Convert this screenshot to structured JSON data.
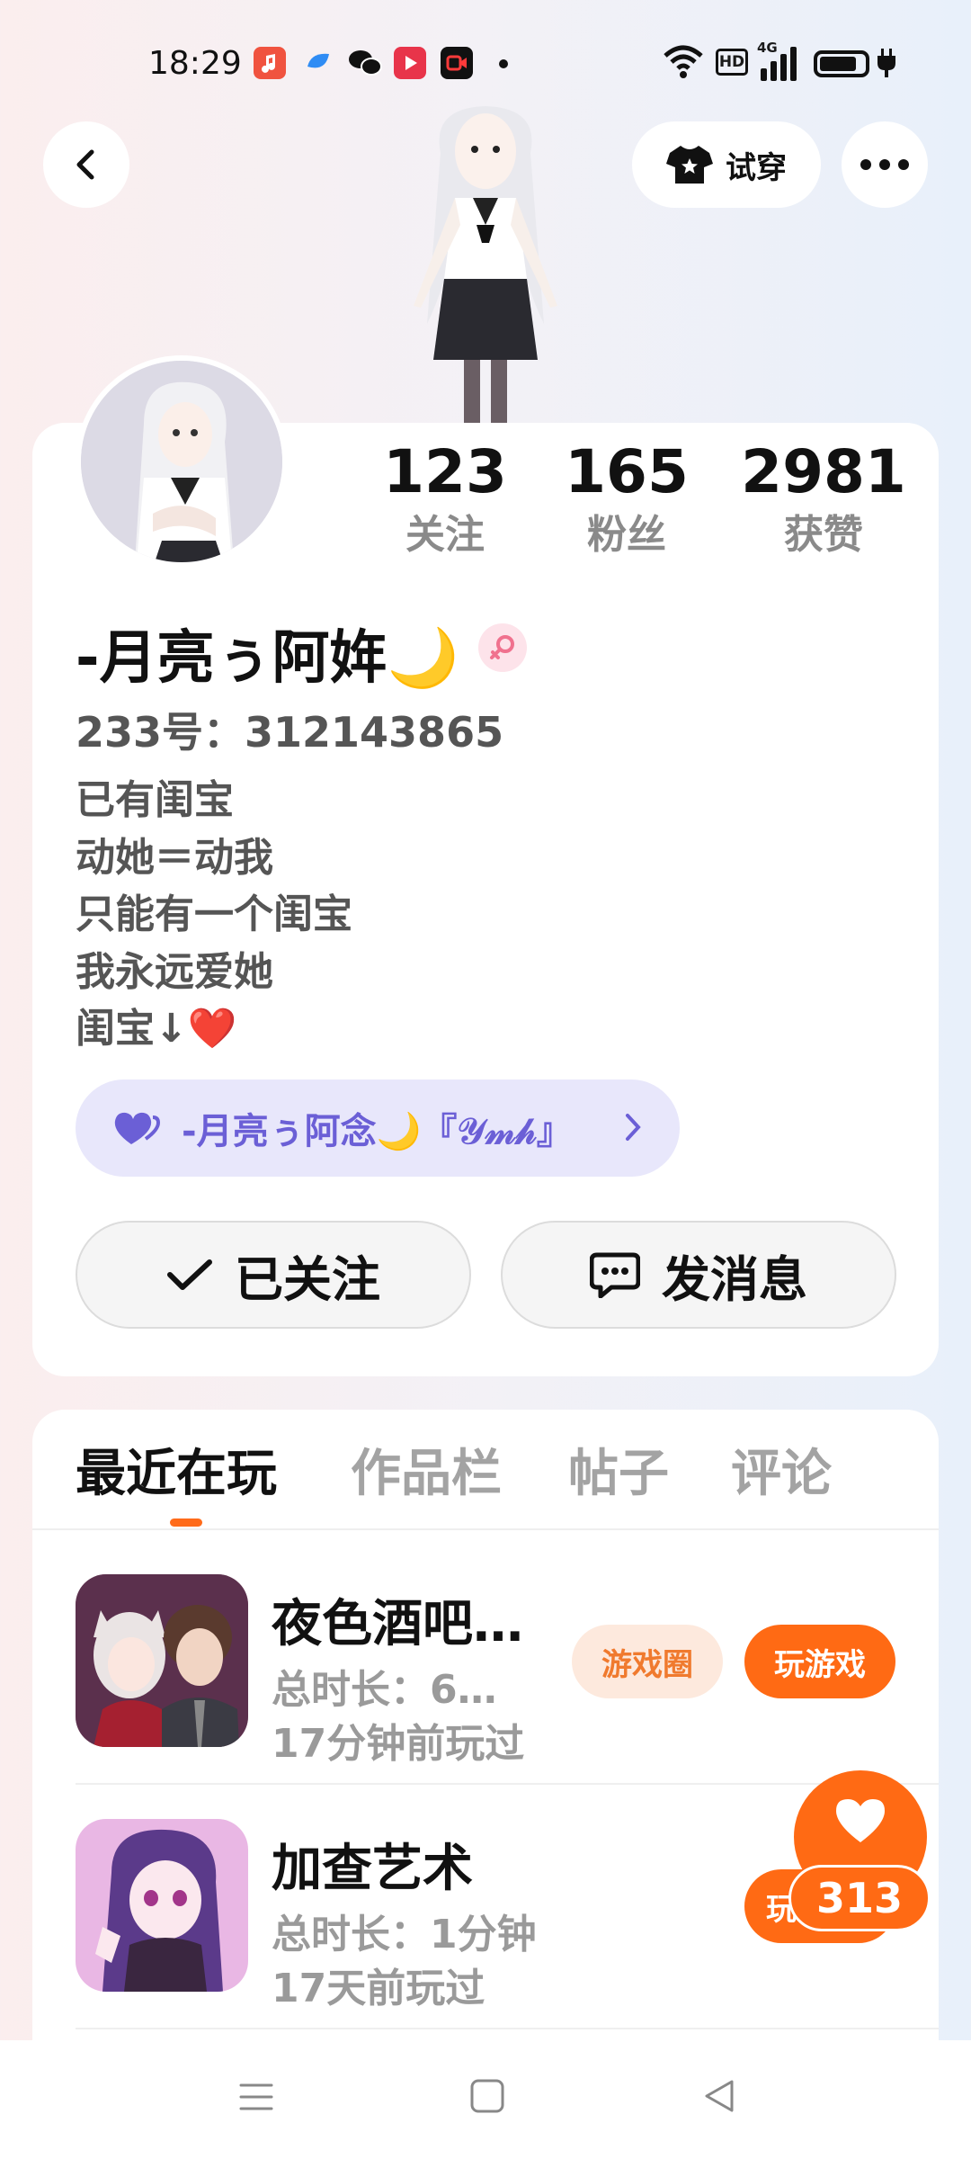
{
  "status_bar": {
    "time": "18:29",
    "icons": [
      "music-app-icon",
      "browser-app-icon",
      "wechat-icon",
      "video-app-icon",
      "recorder-app-icon",
      "notification-dot",
      "wifi-icon",
      "hd-icon",
      "4g-signal-icon",
      "battery-icon"
    ],
    "hd_label": "HD",
    "network_label": "4G"
  },
  "header": {
    "tryon_label": "试穿"
  },
  "profile": {
    "stats": [
      {
        "value": "123",
        "label": "关注"
      },
      {
        "value": "165",
        "label": "粉丝"
      },
      {
        "value": "2981",
        "label": "获赞"
      }
    ],
    "nickname": "-月亮ぅ阿姩🌙",
    "gender": "female",
    "account_id": "233号：312143865",
    "bio": [
      "已有闺宝",
      "动她＝动我",
      "只能有一个闺宝",
      "我永远爱她",
      "闺宝↓❤️"
    ],
    "linked_user": "-月亮ぅ阿念🌙『𝒴𝓂𝒽』",
    "follow_label": "已关注",
    "message_label": "发消息"
  },
  "tabs": [
    {
      "label": "最近在玩",
      "active": true
    },
    {
      "label": "作品栏",
      "active": false
    },
    {
      "label": "帖子",
      "active": false
    },
    {
      "label": "评论",
      "active": false
    }
  ],
  "games": [
    {
      "title": "夜色酒吧…",
      "duration": "总时长：6…",
      "last_played": "17分钟前玩过",
      "circle_label": "游戏圈",
      "play_label": "玩游戏"
    },
    {
      "title": "加查艺术",
      "duration": "总时长：1分钟",
      "last_played": "17天前玩过",
      "play_label": "玩"
    }
  ],
  "like": {
    "count": "313"
  },
  "colors": {
    "accent": "#ff6a14",
    "link_purple": "#6b5fd6",
    "muted": "#9a9a9a"
  }
}
